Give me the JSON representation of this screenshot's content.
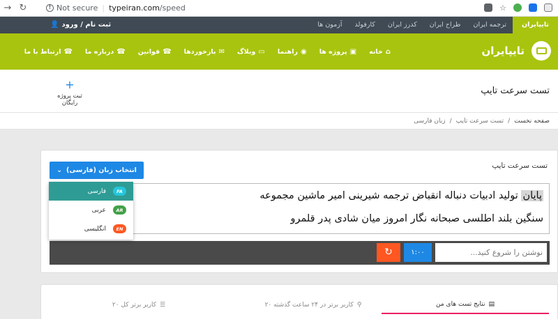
{
  "browser": {
    "security_label": "Not secure",
    "url_host": "typeiran.com",
    "url_path": "/speed"
  },
  "topbar": {
    "login_label": "ثبت نام / ورود",
    "tabs": [
      "تایپایران",
      "ترجمه ایران",
      "طراح ایران",
      "کدرز ایران",
      "کارفولد",
      "آزمون ها"
    ]
  },
  "header": {
    "logo_text": "تایپایران",
    "menu": [
      "خانه",
      "پروژه ها",
      "راهنما",
      "وبلاگ",
      "بازخوردها",
      "قوانین",
      "درباره ما",
      "ارتباط با ما"
    ]
  },
  "page": {
    "title": "تست سرعت تایپ",
    "free_project": "ثبت پروژه رایگان"
  },
  "breadcrumb": [
    "صفحه نخست",
    "/",
    "تست سرعت تایپ",
    "/",
    "زبان فارسی"
  ],
  "typing": {
    "card_title": "تست سرعت تایپ",
    "lang_button": "انتخاب زبان (فارسی)",
    "highlight_word": "پایان",
    "line1_rest": "تولید ادبیات دنباله انقباض ترجمه شیرینی امیر ماشین مجموعه",
    "line2": "سنگین بلند اطلسی صبحانه نگار امروز میان شادی پدر قلمرو",
    "input_placeholder": "نوشتن را شروع کنید...",
    "timer": "۱:۰۰"
  },
  "languages": [
    {
      "label": "فارسی",
      "code": "FA",
      "color": "#26c6da"
    },
    {
      "label": "عربی",
      "code": "AR",
      "color": "#43a047"
    },
    {
      "label": "انگلیسی",
      "code": "EN",
      "color": "#ff5722"
    }
  ],
  "results_tabs": [
    "نتایج تست های من",
    "۲۰ کاربر برتر در ۲۴ ساعت گذشته",
    "۲۰ کاربر برتر کل"
  ]
}
